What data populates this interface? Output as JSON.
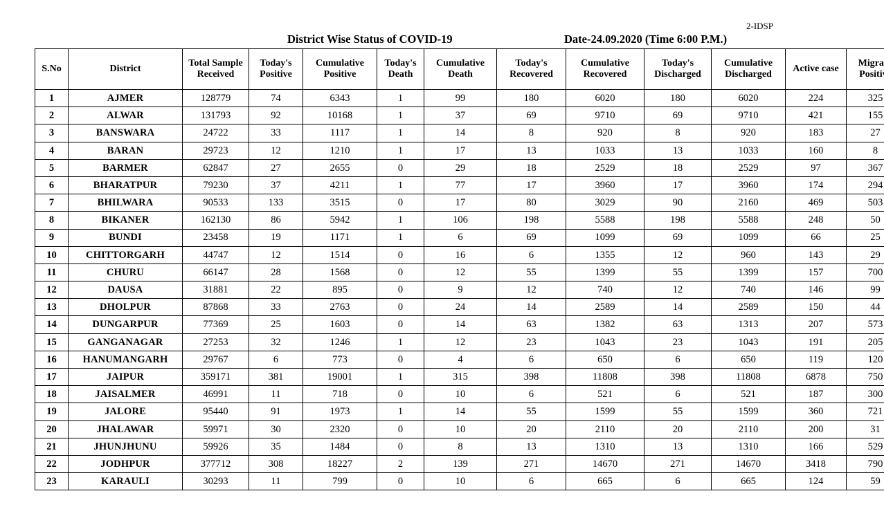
{
  "corner_label": "2-IDSP",
  "header": {
    "title": "District Wise Status of  COVID-19",
    "date": "Date-24.09.2020 (Time 6:00 P.M.)"
  },
  "table": {
    "columns": [
      {
        "key": "sno",
        "line1": "S.No",
        "line2": ""
      },
      {
        "key": "district",
        "line1": "District",
        "line2": ""
      },
      {
        "key": "sample",
        "line1": "Total Sample",
        "line2": "Received"
      },
      {
        "key": "tpos",
        "line1": "Today's",
        "line2": "Positive"
      },
      {
        "key": "cpos",
        "line1": "Cumulative",
        "line2": "Positive"
      },
      {
        "key": "tdeath",
        "line1": "Today's",
        "line2": "Death"
      },
      {
        "key": "cdeath",
        "line1": "Cumulative",
        "line2": "Death"
      },
      {
        "key": "trec",
        "line1": "Today's",
        "line2": "Recovered"
      },
      {
        "key": "crec",
        "line1": "Cumulative",
        "line2": "Recovered"
      },
      {
        "key": "tdis",
        "line1": "Today's",
        "line2": "Discharged"
      },
      {
        "key": "cdis",
        "line1": "Cumulative",
        "line2": "Discharged"
      },
      {
        "key": "active",
        "line1": "Active  case",
        "line2": ""
      },
      {
        "key": "migrant",
        "line1": "Migrant",
        "line2": "Positive"
      }
    ],
    "rows": [
      {
        "sno": "1",
        "district": "AJMER",
        "sample": "128779",
        "tpos": "74",
        "cpos": "6343",
        "tdeath": "1",
        "cdeath": "99",
        "trec": "180",
        "crec": "6020",
        "tdis": "180",
        "cdis": "6020",
        "active": "224",
        "migrant": "325"
      },
      {
        "sno": "2",
        "district": "ALWAR",
        "sample": "131793",
        "tpos": "92",
        "cpos": "10168",
        "tdeath": "1",
        "cdeath": "37",
        "trec": "69",
        "crec": "9710",
        "tdis": "69",
        "cdis": "9710",
        "active": "421",
        "migrant": "155"
      },
      {
        "sno": "3",
        "district": "BANSWARA",
        "sample": "24722",
        "tpos": "33",
        "cpos": "1117",
        "tdeath": "1",
        "cdeath": "14",
        "trec": "8",
        "crec": "920",
        "tdis": "8",
        "cdis": "920",
        "active": "183",
        "migrant": "27"
      },
      {
        "sno": "4",
        "district": "BARAN",
        "sample": "29723",
        "tpos": "12",
        "cpos": "1210",
        "tdeath": "1",
        "cdeath": "17",
        "trec": "13",
        "crec": "1033",
        "tdis": "13",
        "cdis": "1033",
        "active": "160",
        "migrant": "8"
      },
      {
        "sno": "5",
        "district": "BARMER",
        "sample": "62847",
        "tpos": "27",
        "cpos": "2655",
        "tdeath": "0",
        "cdeath": "29",
        "trec": "18",
        "crec": "2529",
        "tdis": "18",
        "cdis": "2529",
        "active": "97",
        "migrant": "367"
      },
      {
        "sno": "6",
        "district": "BHARATPUR",
        "sample": "79230",
        "tpos": "37",
        "cpos": "4211",
        "tdeath": "1",
        "cdeath": "77",
        "trec": "17",
        "crec": "3960",
        "tdis": "17",
        "cdis": "3960",
        "active": "174",
        "migrant": "294"
      },
      {
        "sno": "7",
        "district": "BHILWARA",
        "sample": "90533",
        "tpos": "133",
        "cpos": "3515",
        "tdeath": "0",
        "cdeath": "17",
        "trec": "80",
        "crec": "3029",
        "tdis": "90",
        "cdis": "2160",
        "active": "469",
        "migrant": "503"
      },
      {
        "sno": "8",
        "district": "BIKANER",
        "sample": "162130",
        "tpos": "86",
        "cpos": "5942",
        "tdeath": "1",
        "cdeath": "106",
        "trec": "198",
        "crec": "5588",
        "tdis": "198",
        "cdis": "5588",
        "active": "248",
        "migrant": "50"
      },
      {
        "sno": "9",
        "district": "BUNDI",
        "sample": "23458",
        "tpos": "19",
        "cpos": "1171",
        "tdeath": "1",
        "cdeath": "6",
        "trec": "69",
        "crec": "1099",
        "tdis": "69",
        "cdis": "1099",
        "active": "66",
        "migrant": "25"
      },
      {
        "sno": "10",
        "district": "CHITTORGARH",
        "sample": "44747",
        "tpos": "12",
        "cpos": "1514",
        "tdeath": "0",
        "cdeath": "16",
        "trec": "6",
        "crec": "1355",
        "tdis": "12",
        "cdis": "960",
        "active": "143",
        "migrant": "29"
      },
      {
        "sno": "11",
        "district": "CHURU",
        "sample": "66147",
        "tpos": "28",
        "cpos": "1568",
        "tdeath": "0",
        "cdeath": "12",
        "trec": "55",
        "crec": "1399",
        "tdis": "55",
        "cdis": "1399",
        "active": "157",
        "migrant": "700"
      },
      {
        "sno": "12",
        "district": "DAUSA",
        "sample": "31881",
        "tpos": "22",
        "cpos": "895",
        "tdeath": "0",
        "cdeath": "9",
        "trec": "12",
        "crec": "740",
        "tdis": "12",
        "cdis": "740",
        "active": "146",
        "migrant": "99"
      },
      {
        "sno": "13",
        "district": "DHOLPUR",
        "sample": "87868",
        "tpos": "33",
        "cpos": "2763",
        "tdeath": "0",
        "cdeath": "24",
        "trec": "14",
        "crec": "2589",
        "tdis": "14",
        "cdis": "2589",
        "active": "150",
        "migrant": "44"
      },
      {
        "sno": "14",
        "district": "DUNGARPUR",
        "sample": "77369",
        "tpos": "25",
        "cpos": "1603",
        "tdeath": "0",
        "cdeath": "14",
        "trec": "63",
        "crec": "1382",
        "tdis": "63",
        "cdis": "1313",
        "active": "207",
        "migrant": "573"
      },
      {
        "sno": "15",
        "district": "GANGANAGAR",
        "sample": "27253",
        "tpos": "32",
        "cpos": "1246",
        "tdeath": "1",
        "cdeath": "12",
        "trec": "23",
        "crec": "1043",
        "tdis": "23",
        "cdis": "1043",
        "active": "191",
        "migrant": "205"
      },
      {
        "sno": "16",
        "district": "HANUMANGARH",
        "sample": "29767",
        "tpos": "6",
        "cpos": "773",
        "tdeath": "0",
        "cdeath": "4",
        "trec": "6",
        "crec": "650",
        "tdis": "6",
        "cdis": "650",
        "active": "119",
        "migrant": "120"
      },
      {
        "sno": "17",
        "district": "JAIPUR",
        "sample": "359171",
        "tpos": "381",
        "cpos": "19001",
        "tdeath": "1",
        "cdeath": "315",
        "trec": "398",
        "crec": "11808",
        "tdis": "398",
        "cdis": "11808",
        "active": "6878",
        "migrant": "750"
      },
      {
        "sno": "18",
        "district": "JAISALMER",
        "sample": "46991",
        "tpos": "11",
        "cpos": "718",
        "tdeath": "0",
        "cdeath": "10",
        "trec": "6",
        "crec": "521",
        "tdis": "6",
        "cdis": "521",
        "active": "187",
        "migrant": "300"
      },
      {
        "sno": "19",
        "district": "JALORE",
        "sample": "95440",
        "tpos": "91",
        "cpos": "1973",
        "tdeath": "1",
        "cdeath": "14",
        "trec": "55",
        "crec": "1599",
        "tdis": "55",
        "cdis": "1599",
        "active": "360",
        "migrant": "721"
      },
      {
        "sno": "20",
        "district": "JHALAWAR",
        "sample": "59971",
        "tpos": "30",
        "cpos": "2320",
        "tdeath": "0",
        "cdeath": "10",
        "trec": "20",
        "crec": "2110",
        "tdis": "20",
        "cdis": "2110",
        "active": "200",
        "migrant": "31"
      },
      {
        "sno": "21",
        "district": "JHUNJHUNU",
        "sample": "59926",
        "tpos": "35",
        "cpos": "1484",
        "tdeath": "0",
        "cdeath": "8",
        "trec": "13",
        "crec": "1310",
        "tdis": "13",
        "cdis": "1310",
        "active": "166",
        "migrant": "529"
      },
      {
        "sno": "22",
        "district": "JODHPUR",
        "sample": "377712",
        "tpos": "308",
        "cpos": "18227",
        "tdeath": "2",
        "cdeath": "139",
        "trec": "271",
        "crec": "14670",
        "tdis": "271",
        "cdis": "14670",
        "active": "3418",
        "migrant": "790"
      },
      {
        "sno": "23",
        "district": "KARAULI",
        "sample": "30293",
        "tpos": "11",
        "cpos": "799",
        "tdeath": "0",
        "cdeath": "10",
        "trec": "6",
        "crec": "665",
        "tdis": "6",
        "cdis": "665",
        "active": "124",
        "migrant": "59"
      }
    ]
  }
}
